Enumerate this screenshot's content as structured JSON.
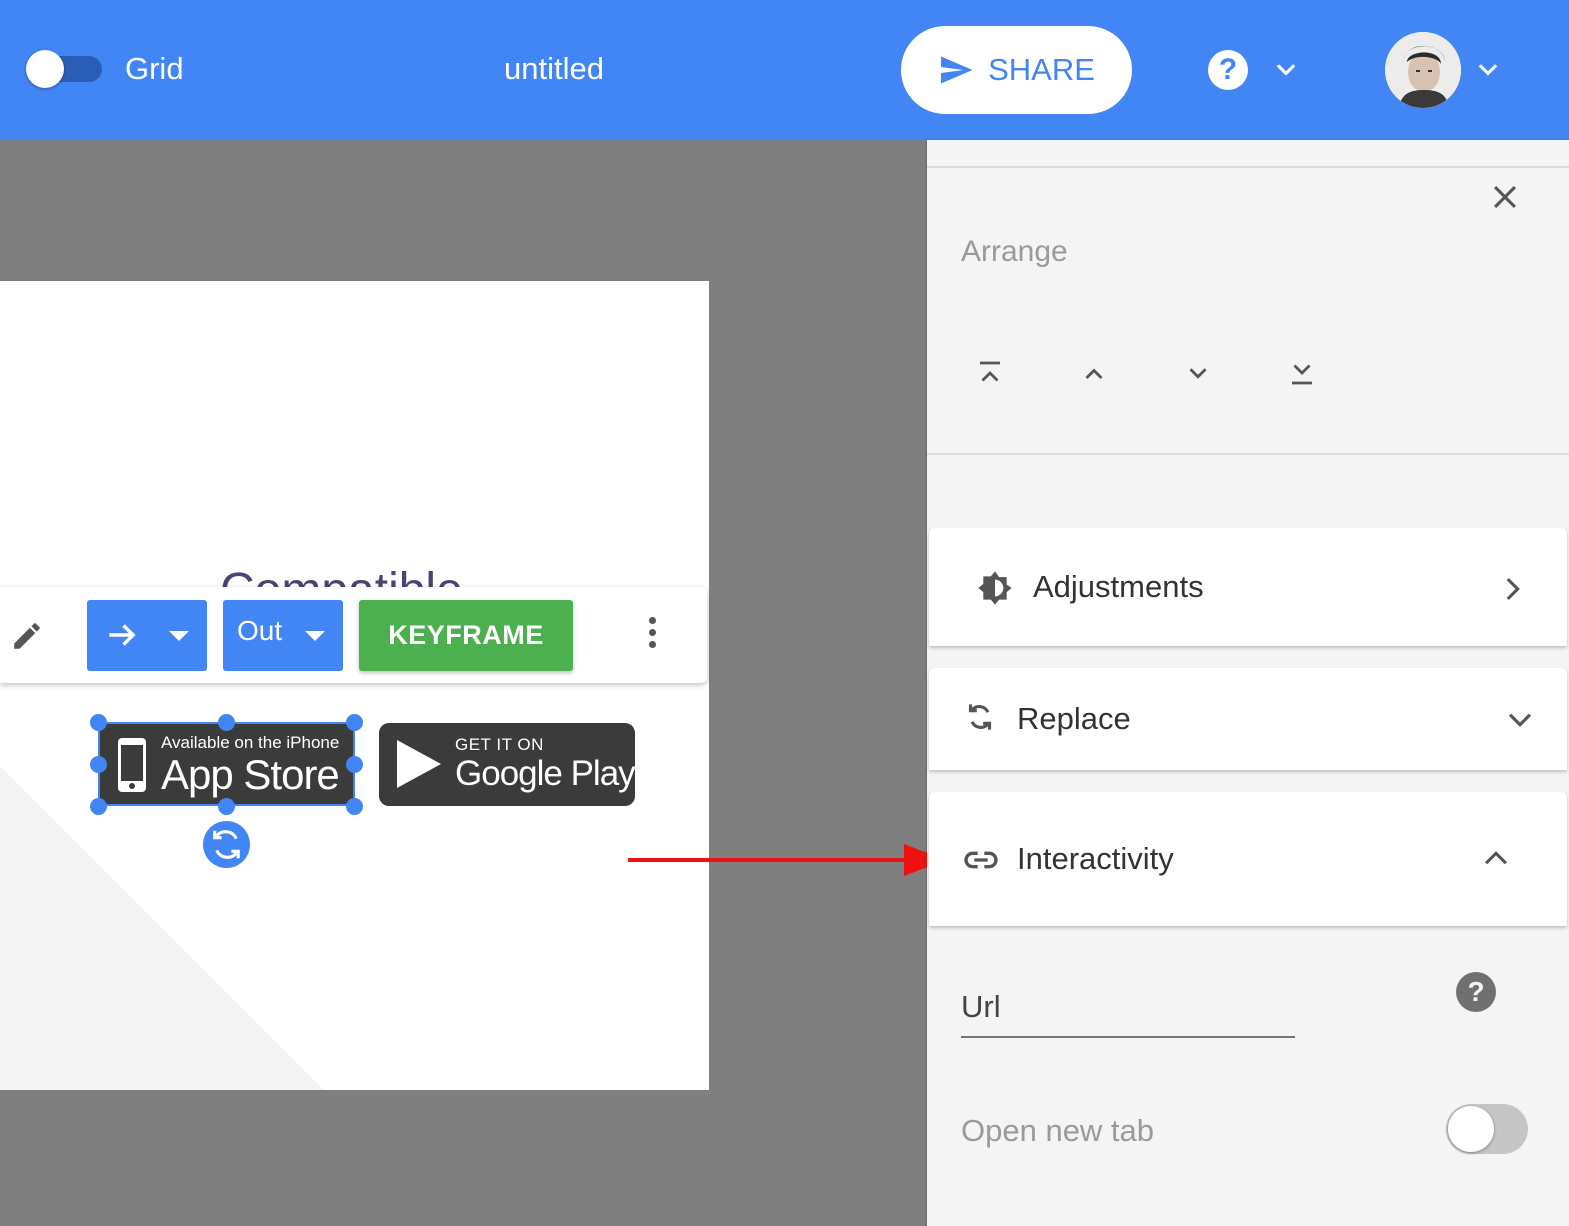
{
  "header": {
    "grid_label": "Grid",
    "grid_toggle_on": false,
    "doc_title": "untitled",
    "share_label": "SHARE",
    "help_symbol": "?",
    "accent_color": "#4285f4"
  },
  "canvas": {
    "slide_heading": "Compatible",
    "toolbar": {
      "edit_icon": "pencil-icon",
      "direction_icon": "arrow-right-icon",
      "mode_label": "Out",
      "keyframe_label": "KEYFRAME",
      "more_icon": "more-vert-icon",
      "keyframe_color": "#4caf50"
    },
    "badges": {
      "appstore_line1": "Available on the iPhone",
      "appstore_line2": "App Store",
      "googleplay_line1": "GET IT ON",
      "googleplay_line2": "Google Play"
    }
  },
  "panel": {
    "arrange_title": "Arrange",
    "arrange_actions": [
      "bring-to-front-icon",
      "bring-forward-icon",
      "send-backward-icon",
      "send-to-back-icon"
    ],
    "sections": {
      "adjustments": "Adjustments",
      "replace": "Replace",
      "interactivity": "Interactivity"
    },
    "url_label": "Url",
    "url_value": "",
    "open_new_tab_label": "Open new tab",
    "open_new_tab_on": false
  }
}
